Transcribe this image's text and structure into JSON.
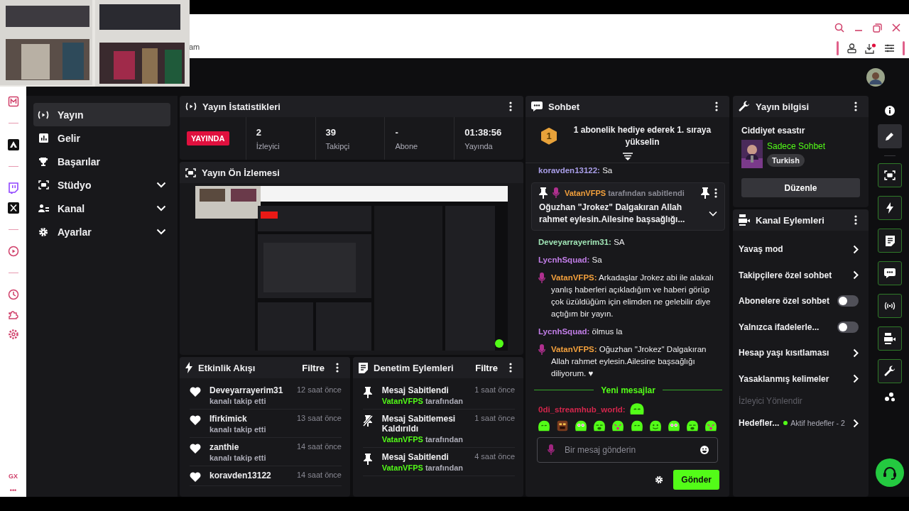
{
  "browser": {
    "address": "am",
    "side_labels": [
      "GX",
      "•••"
    ]
  },
  "nav": [
    {
      "label": "Yayın",
      "selected": true,
      "kind": "link"
    },
    {
      "label": "Gelir",
      "selected": false,
      "kind": "link"
    },
    {
      "label": "Başarılar",
      "selected": false,
      "kind": "link"
    },
    {
      "label": "Stüdyo",
      "selected": false,
      "kind": "group"
    },
    {
      "label": "Kanal",
      "selected": false,
      "kind": "group"
    },
    {
      "label": "Ayarlar",
      "selected": false,
      "kind": "group"
    }
  ],
  "stats": {
    "title": "Yayın İstatistikleri",
    "badge": "YAYINDA",
    "items": [
      {
        "value": "2",
        "label": "İzleyici"
      },
      {
        "value": "39",
        "label": "Takipçi"
      },
      {
        "value": "-",
        "label": "Abone"
      },
      {
        "value": "01:38:56",
        "label": "Yayında"
      }
    ]
  },
  "preview": {
    "title": "Yayın Ön İzlemesi"
  },
  "activity": {
    "title": "Etkinlik Akışı",
    "filter": "Filtre",
    "items": [
      {
        "name": "Deveyarrayerim31",
        "action": "kanalı takip etti",
        "time": "12 saat önce"
      },
      {
        "name": "Ifirkimick",
        "action": "kanalı takip etti",
        "time": "13 saat önce"
      },
      {
        "name": "zanthie",
        "action": "kanalı takip etti",
        "time": "14 saat önce"
      },
      {
        "name": "koravden13122",
        "time": "14 saat önce"
      }
    ]
  },
  "moderation": {
    "title": "Denetim Eylemleri",
    "filter": "Filtre",
    "items": [
      {
        "kind": "pin",
        "title": "Mesaj Sabitlendi",
        "by": "VatanVFPS",
        "suffix": "tarafından",
        "time": "1 saat önce"
      },
      {
        "kind": "unpin",
        "title": "Mesaj Sabitlemesi Kaldırıldı",
        "by": "VatanVFPS",
        "suffix": "tarafından",
        "time": "1 saat önce"
      },
      {
        "kind": "pin",
        "title": "Mesaj Sabitlendi",
        "by": "VatanVFPS",
        "suffix": "tarafından",
        "time": "4 saat önce"
      }
    ]
  },
  "chat": {
    "title": "Sohbet",
    "promo": {
      "rank": "1",
      "text": "1 abonelik hediye ederek 1. sıraya yükselin"
    },
    "pinned": {
      "user": "VatanVFPS",
      "note": "tarafından sabitlendi",
      "text": "Oğuzhan \"Jrokez\" Dalgakıran Allah rahmet eylesin.Ailesine başsağlığı..."
    },
    "messages": [
      {
        "kind": "text",
        "user": "koravden13122:",
        "color": "#a99ee8",
        "mic": false,
        "text": " Sa"
      },
      {
        "kind": "text",
        "user": "Deveyarrayerim31:",
        "color": "#9fe3b4",
        "mic": false,
        "text": " SA"
      },
      {
        "kind": "text",
        "user": "LycnhSquad:",
        "color": "#c27ee8",
        "mic": false,
        "text": " Sa"
      },
      {
        "kind": "text",
        "user": "VatanVFPS:",
        "color": "#f3a03c",
        "mic": true,
        "text": " Arkadaşlar Jrokez abi ile alakalı yanlış haberleri açıkladığım ve haberi görüp çok üzüldüğüm için elimden ne gelebilir diye açtığım bir yayın."
      },
      {
        "kind": "text",
        "user": "LycnhSquad:",
        "color": "#c27ee8",
        "mic": false,
        "text": " ölmus la"
      },
      {
        "kind": "text",
        "user": "VatanVFPS:",
        "color": "#f3a03c",
        "mic": true,
        "text": " Oğuzhan \"Jrokez\" Dalgakıran Allah rahmet eylesin.Ailesine başsağlığı diliyorum. ♥"
      }
    ],
    "divider": "Yeni mesajlar",
    "new_messages": [
      {
        "kind": "emote",
        "user": "0di_streamhub_world:",
        "color": "#d3264c",
        "mic": false
      }
    ],
    "input": {
      "placeholder": "Bir mesaj gönderin"
    },
    "send": "Gönder"
  },
  "stream_info": {
    "title": "Yayın bilgisi",
    "stream_title": "Ciddiyet esastır",
    "category": "Sadece Sohbet",
    "tag": "Turkish",
    "edit": "Düzenle"
  },
  "channel_actions": {
    "title": "Kanal Eylemleri",
    "items": [
      {
        "kind": "link",
        "label": "Yavaş mod"
      },
      {
        "kind": "link",
        "label": "Takipçilere özel sohbet"
      },
      {
        "kind": "toggle",
        "label": "Abonelere özel sohbet",
        "on": false
      },
      {
        "kind": "toggle",
        "label": "Yalnızca ifadelerle...",
        "on": false
      },
      {
        "kind": "link",
        "label": "Hesap yaşı kısıtlaması"
      },
      {
        "kind": "link",
        "label": "Yasaklanmış kelimeler"
      },
      {
        "kind": "section",
        "label": "İzleyici Yönlendir"
      },
      {
        "kind": "goal",
        "label": "Hedefler...",
        "status": "Aktif hedefler - 2",
        "color": "#53fc18"
      }
    ]
  }
}
